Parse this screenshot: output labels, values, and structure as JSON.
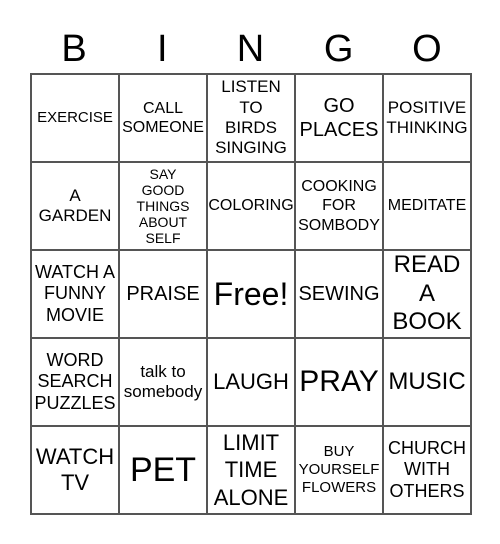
{
  "header": [
    "B",
    "I",
    "N",
    "G",
    "O"
  ],
  "cells": [
    [
      "EXERCISE",
      "CALL SOMEONE",
      "LISTEN TO BIRDS SINGING",
      "GO PLACES",
      "POSITIVE THINKING"
    ],
    [
      "A GARDEN",
      "SAY GOOD THINGS ABOUT SELF",
      "COLORING",
      "COOKING FOR SOMBODY",
      "MEDITATE"
    ],
    [
      "WATCH A FUNNY MOVIE",
      "PRAISE",
      "Free!",
      "SEWING",
      "READ A BOOK"
    ],
    [
      "WORD SEARCH PUZZLES",
      "talk to somebody",
      "LAUGH",
      "PRAY",
      "MUSIC"
    ],
    [
      "WATCH TV",
      "PET",
      "LIMIT TIME ALONE",
      "BUY YOURSELF FLOWERS",
      "CHURCH WITH OTHERS"
    ]
  ]
}
